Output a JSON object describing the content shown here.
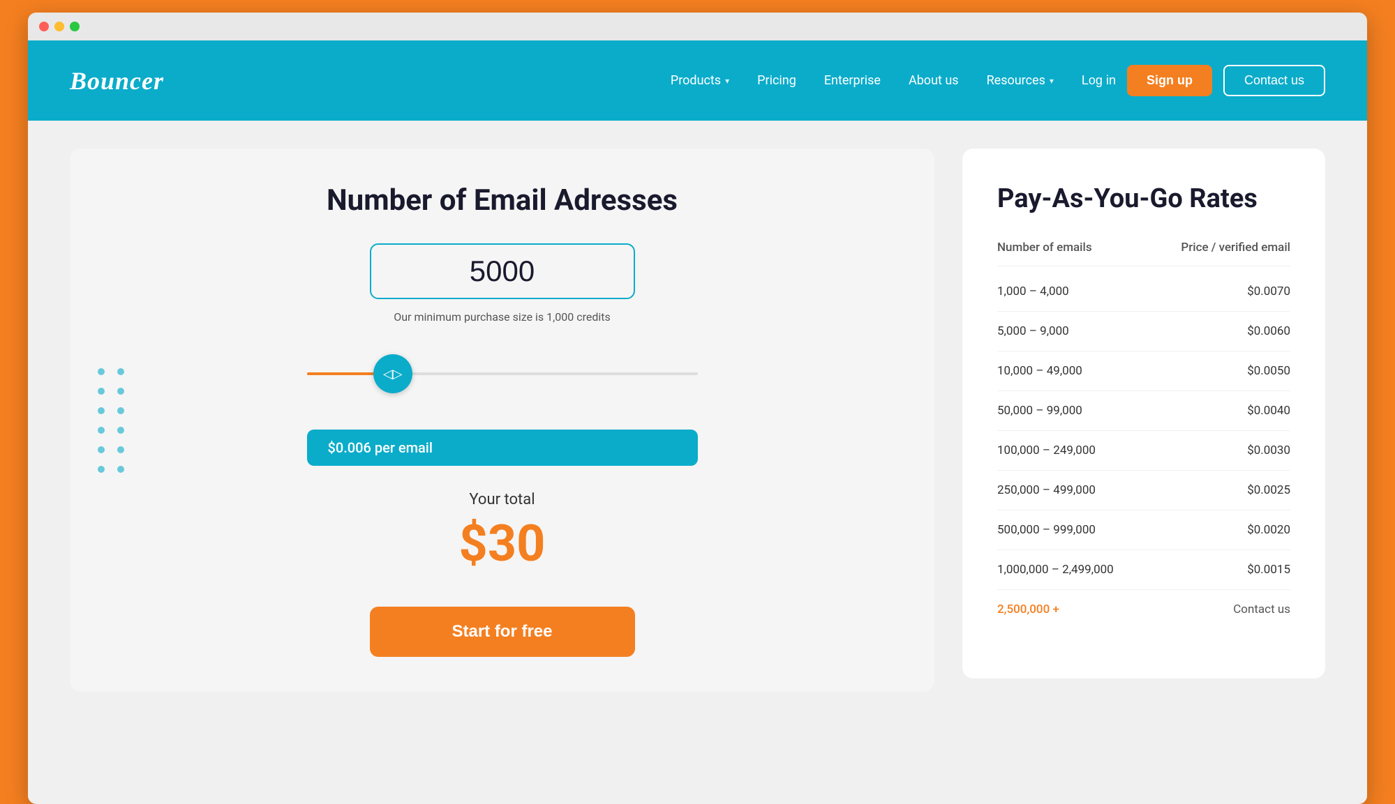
{
  "window": {
    "dots": [
      "red",
      "yellow",
      "green"
    ]
  },
  "navbar": {
    "logo": "Bouncer",
    "links": [
      {
        "label": "Products",
        "hasChevron": true
      },
      {
        "label": "Pricing",
        "hasChevron": false
      },
      {
        "label": "Enterprise",
        "hasChevron": false
      },
      {
        "label": "About us",
        "hasChevron": false
      },
      {
        "label": "Resources",
        "hasChevron": true
      }
    ],
    "login_label": "Log in",
    "signup_label": "Sign up",
    "contact_label": "Contact us"
  },
  "calculator": {
    "title": "Number of Email Adresses",
    "email_count": "5000",
    "min_purchase_text": "Our minimum purchase size is 1,000 credits",
    "price_per_email": "$0.006   per email",
    "your_total_label": "Your total",
    "total_amount": "$30",
    "start_button": "Start for free",
    "slider_fill_percent": 22
  },
  "rates": {
    "title": "Pay-As-You-Go Rates",
    "header": {
      "col1": "Number of emails",
      "col2": "Price / verified email"
    },
    "rows": [
      {
        "range": "1,000 – 4,000",
        "price": "$0.0070"
      },
      {
        "range": "5,000 – 9,000",
        "price": "$0.0060"
      },
      {
        "range": "10,000 – 49,000",
        "price": "$0.0050"
      },
      {
        "range": "50,000 – 99,000",
        "price": "$0.0040"
      },
      {
        "range": "100,000 – 249,000",
        "price": "$0.0030"
      },
      {
        "range": "250,000 – 499,000",
        "price": "$0.0025"
      },
      {
        "range": "500,000 – 999,000",
        "price": "$0.0020"
      },
      {
        "range": "1,000,000 – 2,499,000",
        "price": "$0.0015"
      }
    ],
    "last_row": {
      "range": "2,500,000 +",
      "contact": "Contact us"
    }
  }
}
